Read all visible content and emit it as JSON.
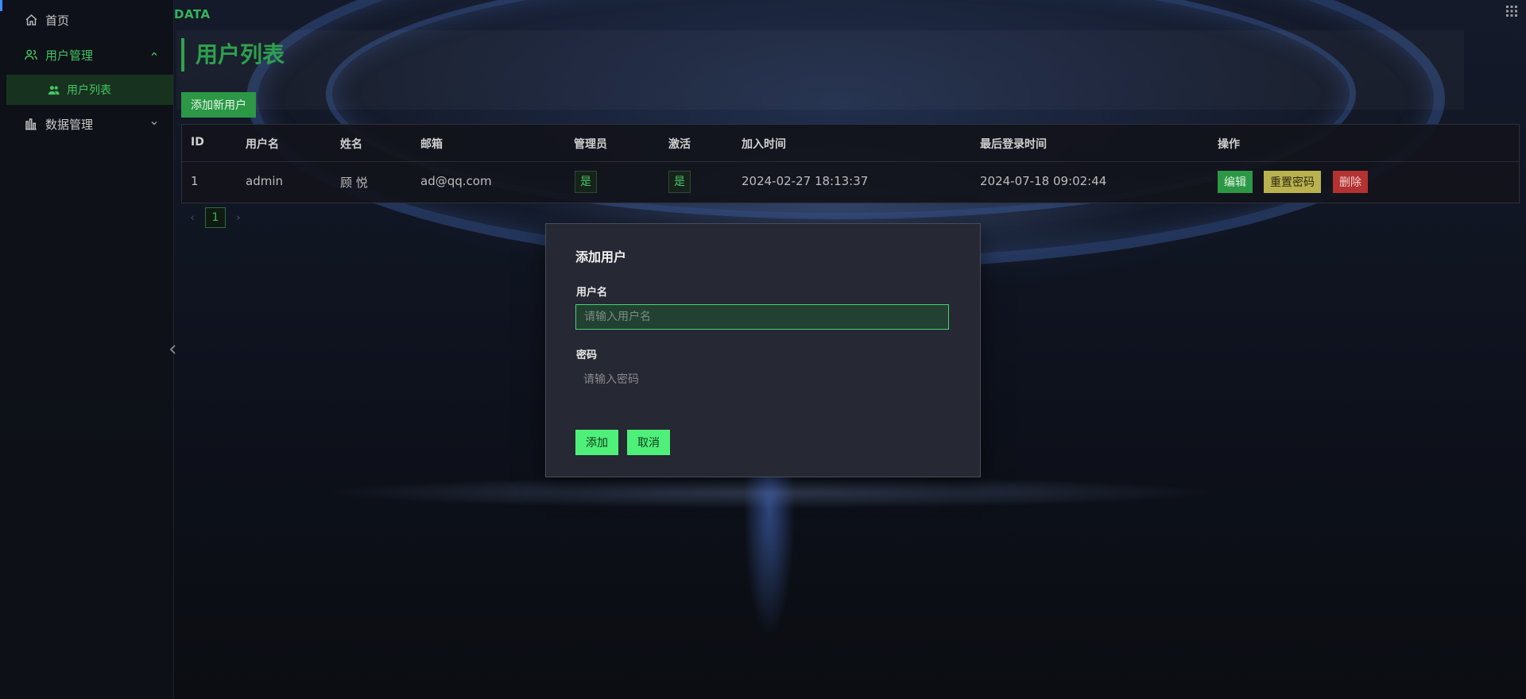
{
  "brand": "DATA",
  "sidebar": {
    "items": [
      {
        "label": "首页",
        "icon": "home-icon"
      },
      {
        "label": "用户管理",
        "icon": "users-icon",
        "expanded": true
      },
      {
        "label": "用户列表",
        "icon": "users-icon",
        "active": true
      },
      {
        "label": "数据管理",
        "icon": "chart-bar-icon",
        "expanded": false
      }
    ]
  },
  "page": {
    "title": "用户列表",
    "add_button": "添加新用户"
  },
  "table": {
    "columns": [
      "ID",
      "用户名",
      "姓名",
      "邮箱",
      "管理员",
      "激活",
      "加入时间",
      "最后登录时间",
      "操作"
    ],
    "rows": [
      {
        "id": "1",
        "username": "admin",
        "name": "顾 悦",
        "email": "ad@qq.com",
        "is_admin": "是",
        "active": "是",
        "joined": "2024-02-27 18:13:37",
        "last_login": "2024-07-18 09:02:44",
        "actions": {
          "edit": "编辑",
          "reset": "重置密码",
          "delete": "删除"
        }
      }
    ]
  },
  "pagination": {
    "prev": "‹",
    "current": "1",
    "next": "›"
  },
  "modal": {
    "title": "添加用户",
    "username_label": "用户名",
    "username_placeholder": "请输入用户名",
    "password_label": "密码",
    "password_placeholder": "请输入密码",
    "submit": "添加",
    "cancel": "取消"
  },
  "colors": {
    "accent_green": "#2ea04d",
    "edit_button": "#2c9846",
    "reset_button": "#b9b24f",
    "delete_button": "#b33232",
    "modal_button": "#4ff07a"
  }
}
